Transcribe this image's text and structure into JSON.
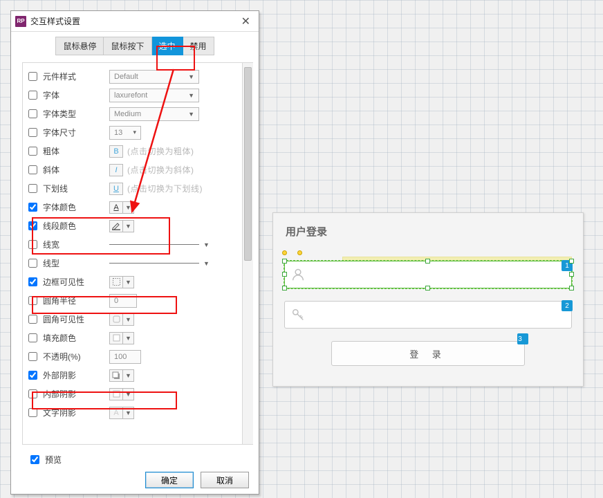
{
  "dialog": {
    "title": "交互样式设置",
    "app_icon": "RP",
    "tabs": [
      "鼠标悬停",
      "鼠标按下",
      "选中",
      "禁用"
    ],
    "active_tab": 2,
    "rows": {
      "widget_style": {
        "label": "元件样式",
        "value": "Default",
        "checked": false
      },
      "font": {
        "label": "字体",
        "value": "laxurefont",
        "checked": false
      },
      "font_type": {
        "label": "字体类型",
        "value": "Medium",
        "checked": false
      },
      "font_size": {
        "label": "字体尺寸",
        "value": "13",
        "checked": false
      },
      "bold": {
        "label": "粗体",
        "icon": "B",
        "hint": "(点击切换为粗体)",
        "checked": false
      },
      "italic": {
        "label": "斜体",
        "icon": "I",
        "hint": "(点击切换为斜体)",
        "checked": false
      },
      "underline": {
        "label": "下划线",
        "icon": "U",
        "hint": "(点击切换为下划线)",
        "checked": false
      },
      "font_color": {
        "label": "字体颜色",
        "checked": true
      },
      "line_color": {
        "label": "线段颜色",
        "checked": true
      },
      "line_width": {
        "label": "线宽",
        "checked": false
      },
      "line_style": {
        "label": "线型",
        "checked": false
      },
      "border_vis": {
        "label": "边框可见性",
        "checked": true
      },
      "corner_radius": {
        "label": "圆角半径",
        "value": "0",
        "checked": false
      },
      "corner_vis": {
        "label": "圆角可见性",
        "checked": false
      },
      "fill_color": {
        "label": "填充颜色",
        "checked": false
      },
      "opacity": {
        "label": "不透明(%)",
        "value": "100",
        "checked": false
      },
      "outer_shadow": {
        "label": "外部阴影",
        "checked": true
      },
      "inner_shadow": {
        "label": "内部阴影",
        "checked": false
      },
      "text_shadow": {
        "label": "文字阴影",
        "checked": false
      }
    },
    "preview_label": "预览",
    "ok": "确定",
    "cancel": "取消"
  },
  "login": {
    "title": "用户登录",
    "button": "登 录",
    "badges": [
      "1",
      "2",
      "3"
    ]
  }
}
